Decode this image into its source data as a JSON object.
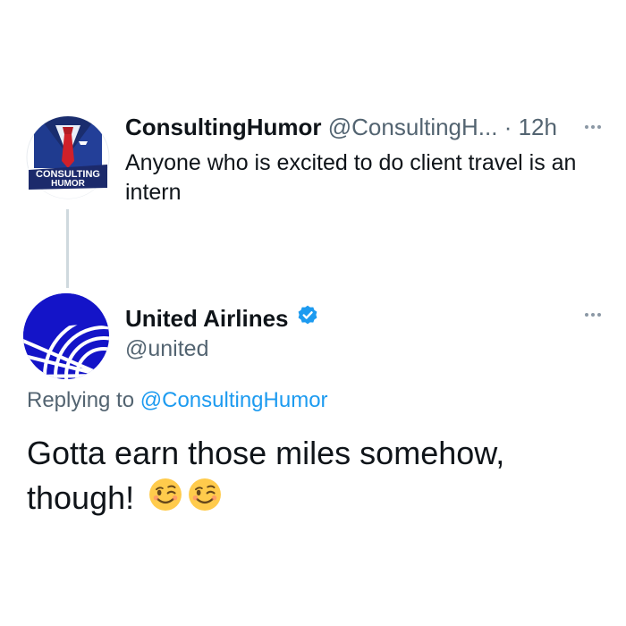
{
  "tweet1": {
    "avatar_label_line1": "CONSULTING",
    "avatar_label_line2": "HUMOR",
    "display_name": "ConsultingHumor",
    "handle": "@ConsultingH...",
    "time": "· 12h",
    "text": "Anyone who is excited to do client travel is an intern"
  },
  "tweet2": {
    "display_name": "United Airlines",
    "verified": true,
    "handle": "@united",
    "replying_prefix": "Replying to",
    "replying_to": "@ConsultingHumor",
    "text": "Gotta earn those miles somehow, though!",
    "emojis": [
      "winking-face",
      "winking-face"
    ]
  },
  "colors": {
    "primary_text": "#0f1419",
    "secondary_text": "#536471",
    "link": "#1d9bf0",
    "verified_badge": "#1d9bf0",
    "united_blue": "#1414c8",
    "consulting_navy": "#1c2a6b",
    "tie_red": "#d0202a"
  },
  "icons": [
    "more-options-icon",
    "verified-badge-icon",
    "winking-face-emoji"
  ]
}
